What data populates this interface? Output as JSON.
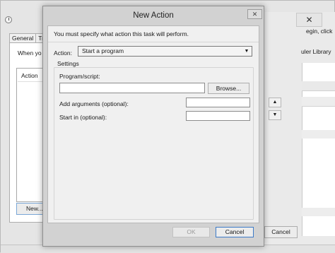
{
  "background_window": {
    "tabs": [
      "General",
      "Tr"
    ],
    "when_text": "When yo",
    "list_header": "Action",
    "new_button": "New...",
    "right_text_1": "egin, click",
    "right_text_2": "uler Library",
    "close_glyph": "✕",
    "up_glyph": "▲",
    "down_glyph": "▼",
    "cancel_button": "Cancel"
  },
  "dialog": {
    "title": "New Action",
    "close_glyph": "✕",
    "instruction": "You must specify what action this task will perform.",
    "action_label": "Action:",
    "action_value": "Start a program",
    "action_chevron": "▼",
    "settings_label": "Settings",
    "program_label": "Program/script:",
    "program_value": "",
    "browse_button": "Browse...",
    "arguments_label": "Add arguments (optional):",
    "arguments_value": "",
    "start_in_label": "Start in (optional):",
    "start_in_value": "",
    "ok_button": "OK",
    "cancel_button": "Cancel"
  },
  "colors": {
    "dialog_frame": "#d2d2d2",
    "dialog_body": "#f0f0f0",
    "focus_border": "#3d7bc7",
    "disabled_text": "#9a9a9a"
  }
}
